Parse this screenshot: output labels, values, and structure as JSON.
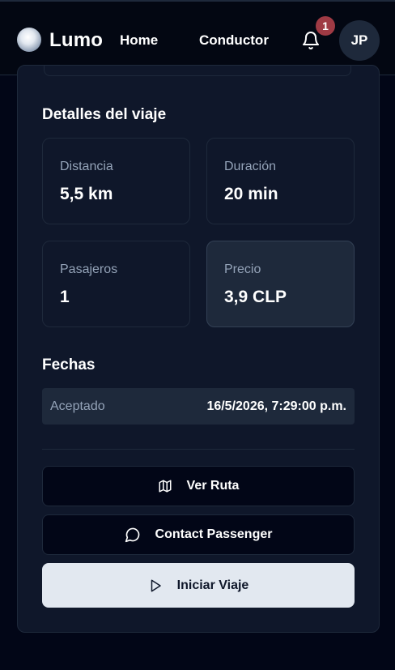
{
  "header": {
    "brand": "Lumo",
    "nav": [
      "Home",
      "Conductor"
    ],
    "notifications_count": "1",
    "avatar_initials": "JP"
  },
  "trip_details": {
    "title": "Detalles del viaje",
    "stats": [
      {
        "label": "Distancia",
        "value": "5,5 km"
      },
      {
        "label": "Duración",
        "value": "20 min"
      },
      {
        "label": "Pasajeros",
        "value": "1"
      },
      {
        "label": "Precio",
        "value": "3,9 CLP"
      }
    ]
  },
  "dates": {
    "title": "Fechas",
    "rows": [
      {
        "label": "Aceptado",
        "value": "16/5/2026, 7:29:00 p.m."
      }
    ]
  },
  "actions": {
    "view_route": "Ver Ruta",
    "contact": "Contact Passenger",
    "start_trip": "Iniciar Viaje"
  },
  "icons": {
    "bell": "bell-icon",
    "map": "map-icon",
    "chat": "message-circle-icon",
    "play": "play-icon"
  },
  "colors": {
    "background": "#020617",
    "card": "#0f172a",
    "badge": "#9f3a44",
    "primary_button": "#e2e8f0"
  }
}
